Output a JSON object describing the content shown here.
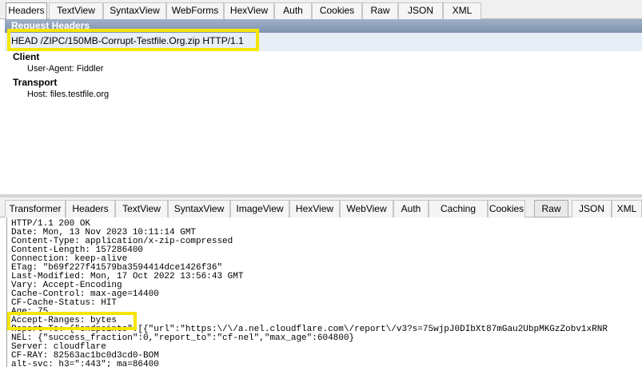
{
  "top_tabs": [
    "Headers",
    "TextView",
    "SyntaxView",
    "WebForms",
    "HexView",
    "Auth",
    "Cookies",
    "Raw",
    "JSON",
    "XML"
  ],
  "request": {
    "panel_title": "Request Headers",
    "request_line": "HEAD /ZIPC/150MB-Corrupt-Testfile.Org.zip HTTP/1.1",
    "groups": [
      {
        "name": "Client",
        "headers": [
          "User-Agent: Fiddler"
        ]
      },
      {
        "name": "Transport",
        "headers": [
          "Host: files.testfile.org"
        ]
      }
    ]
  },
  "bottom_tabs": [
    "Transformer",
    "Headers",
    "TextView",
    "SyntaxView",
    "ImageView",
    "HexView",
    "WebView",
    "Auth",
    "Caching",
    "Cookies",
    "Raw",
    "JSON",
    "XML"
  ],
  "response_raw": [
    "HTTP/1.1 200 OK",
    "Date: Mon, 13 Nov 2023 10:11:14 GMT",
    "Content-Type: application/x-zip-compressed",
    "Content-Length: 157286400",
    "Connection: keep-alive",
    "ETag: \"b69f227f41579ba3594414dce1426f36\"",
    "Last-Modified: Mon, 17 Oct 2022 13:56:43 GMT",
    "Vary: Accept-Encoding",
    "Cache-Control: max-age=14400",
    "CF-Cache-Status: HIT",
    "Age: 75",
    "Accept-Ranges: bytes",
    "Report-To: {\"endpoints\":[{\"url\":\"https:\\/\\/a.nel.cloudflare.com\\/report\\/v3?s=75wjpJ0DIbXt87mGau2UbpMKGzZobv1xRNR",
    "NEL: {\"success_fraction\":0,\"report_to\":\"cf-nel\",\"max_age\":604800}",
    "Server: cloudflare",
    "CF-RAY: 82563ac1bc0d3cd0-BOM",
    "alt-svc: h3=\":443\"; ma=86400"
  ],
  "highlight_color": "#f5e600"
}
